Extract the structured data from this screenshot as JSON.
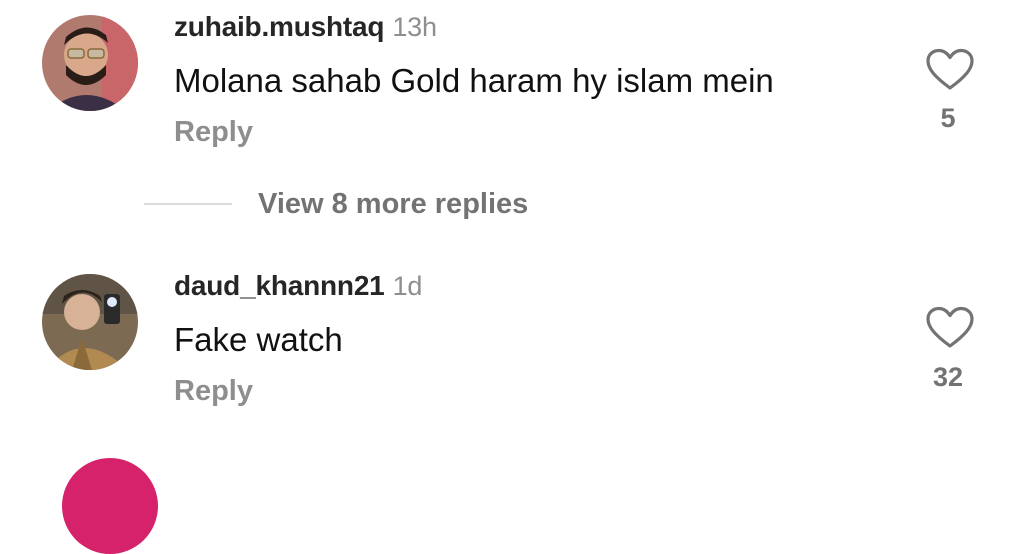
{
  "comments": [
    {
      "username": "zuhaib.mushtaq",
      "time": "13h",
      "text": "Molana sahab Gold haram hy islam mein",
      "reply_label": "Reply",
      "likes": "5",
      "avatar_icon": "user-avatar"
    },
    {
      "username": "daud_khannn21",
      "time": "1d",
      "text": "Fake watch",
      "reply_label": "Reply",
      "likes": "32",
      "avatar_icon": "user-avatar"
    }
  ],
  "view_more": {
    "label": "View 8 more replies"
  },
  "colors": {
    "text": "#111111",
    "muted": "#8e8e8e",
    "divider": "#dbdbdb"
  },
  "icons": {
    "like": "heart-outline-icon"
  }
}
